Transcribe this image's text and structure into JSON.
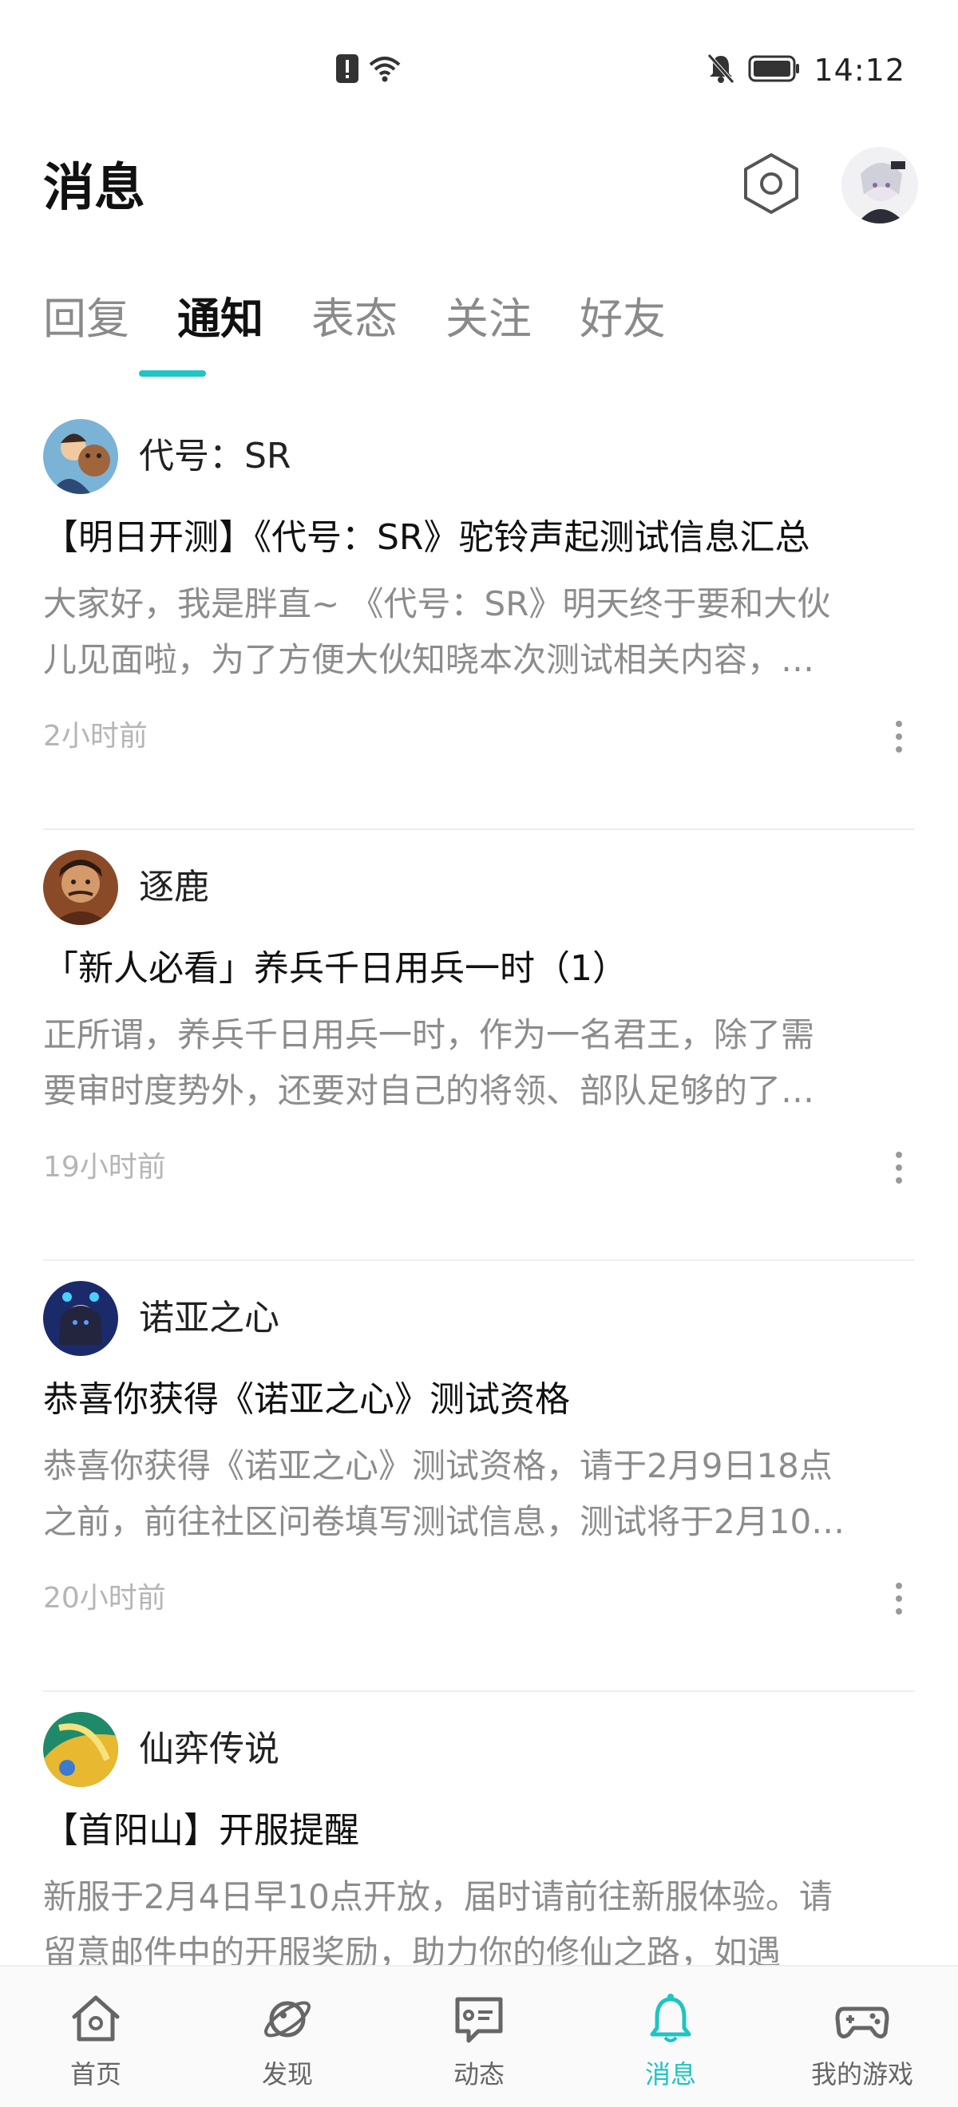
{
  "status_bar": {
    "time": "14:12"
  },
  "header": {
    "title": "消息"
  },
  "tabs": [
    {
      "label": "回复",
      "active": false
    },
    {
      "label": "通知",
      "active": true
    },
    {
      "label": "表态",
      "active": false
    },
    {
      "label": "关注",
      "active": false
    },
    {
      "label": "好友",
      "active": false
    }
  ],
  "notifications": [
    {
      "sender": "代号：SR",
      "title": "【明日开测】《代号：SR》驼铃声起测试信息汇总",
      "body_line1": "大家好，我是胖直~ 《代号：SR》明天终于要和大伙",
      "body_line2": "儿见面啦，为了方便大伙知晓本次测试相关内容，…",
      "time": "2小时前"
    },
    {
      "sender": "逐鹿",
      "title": "「新人必看」养兵千日用兵一时（1）",
      "body_line1": "正所谓，养兵千日用兵一时，作为一名君王，除了需",
      "body_line2": "要审时度势外，还要对自己的将领、部队足够的了…",
      "time": "19小时前"
    },
    {
      "sender": "诺亚之心",
      "title": "恭喜你获得《诺亚之心》测试资格",
      "body_line1": "恭喜你获得《诺亚之心》测试资格，请于2月9日18点",
      "body_line2": "之前，前往社区问卷填写测试信息，测试将于2月10…",
      "time": "20小时前"
    },
    {
      "sender": "仙弈传说",
      "title": "【首阳山】开服提醒",
      "body_line1": "新服于2月4日早10点开放，届时请前往新服体验。请",
      "body_line2": "留意邮件中的开服奖励，助力你的修仙之路，如遇",
      "time": ""
    }
  ],
  "bottom_nav": [
    {
      "label": "首页",
      "icon": "home-icon"
    },
    {
      "label": "发现",
      "icon": "planet-icon"
    },
    {
      "label": "动态",
      "icon": "chat-icon"
    },
    {
      "label": "消息",
      "icon": "bell-icon"
    },
    {
      "label": "我的游戏",
      "icon": "gamepad-icon"
    }
  ],
  "colors": {
    "accent": "#1fc4c4"
  }
}
